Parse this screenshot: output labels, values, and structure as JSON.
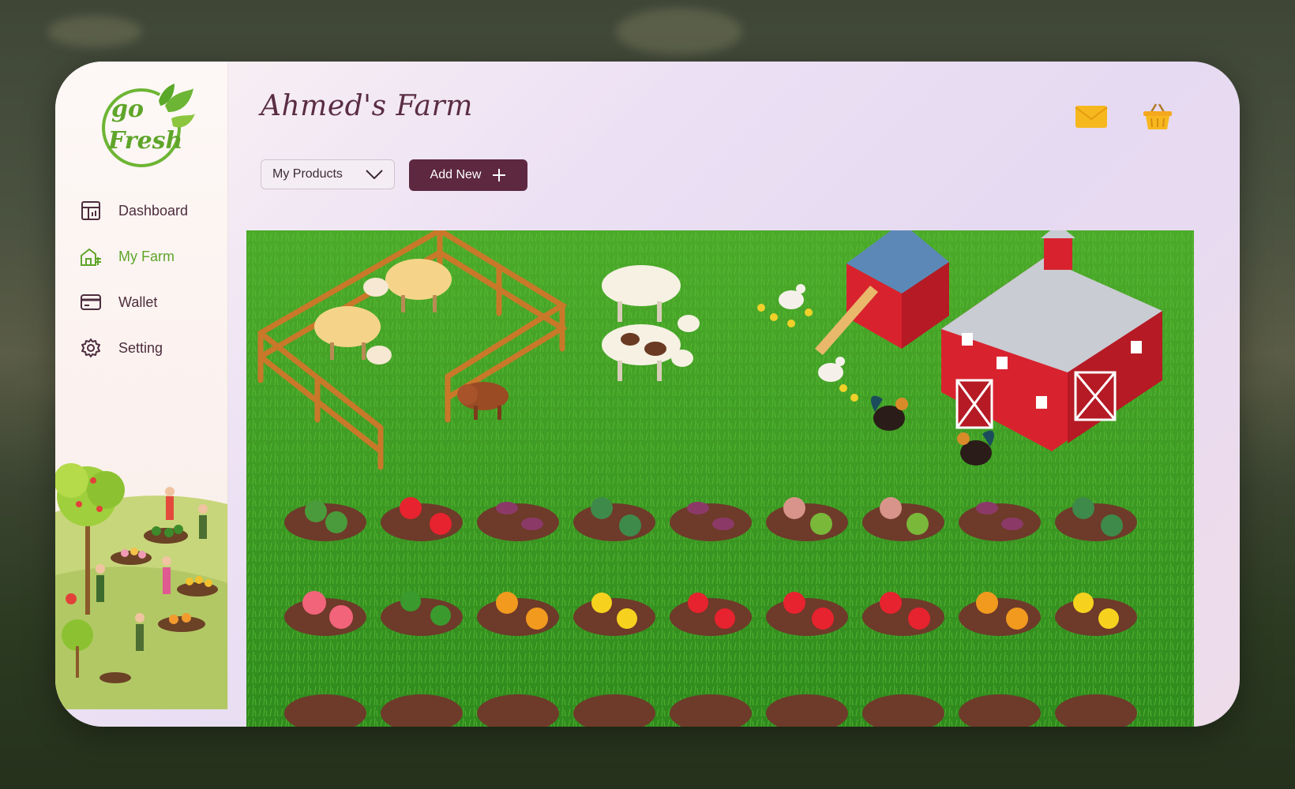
{
  "app": {
    "logo_text": "go Fresh"
  },
  "sidebar": {
    "items": [
      {
        "label": "Dashboard",
        "icon": "dashboard-icon",
        "active": false
      },
      {
        "label": "My Farm",
        "icon": "farm-icon",
        "active": true
      },
      {
        "label": "Wallet",
        "icon": "wallet-icon",
        "active": false
      },
      {
        "label": "Setting",
        "icon": "gear-icon",
        "active": false
      }
    ]
  },
  "header": {
    "title": "Ahmed's Farm",
    "icons": [
      "mail-icon",
      "basket-icon"
    ]
  },
  "toolbar": {
    "select_value": "My Products",
    "add_label": "Add New"
  },
  "colors": {
    "accent": "#5d2840",
    "active_nav": "#5fa52a",
    "grass": "#3d9a22",
    "barn": "#d8232f"
  }
}
